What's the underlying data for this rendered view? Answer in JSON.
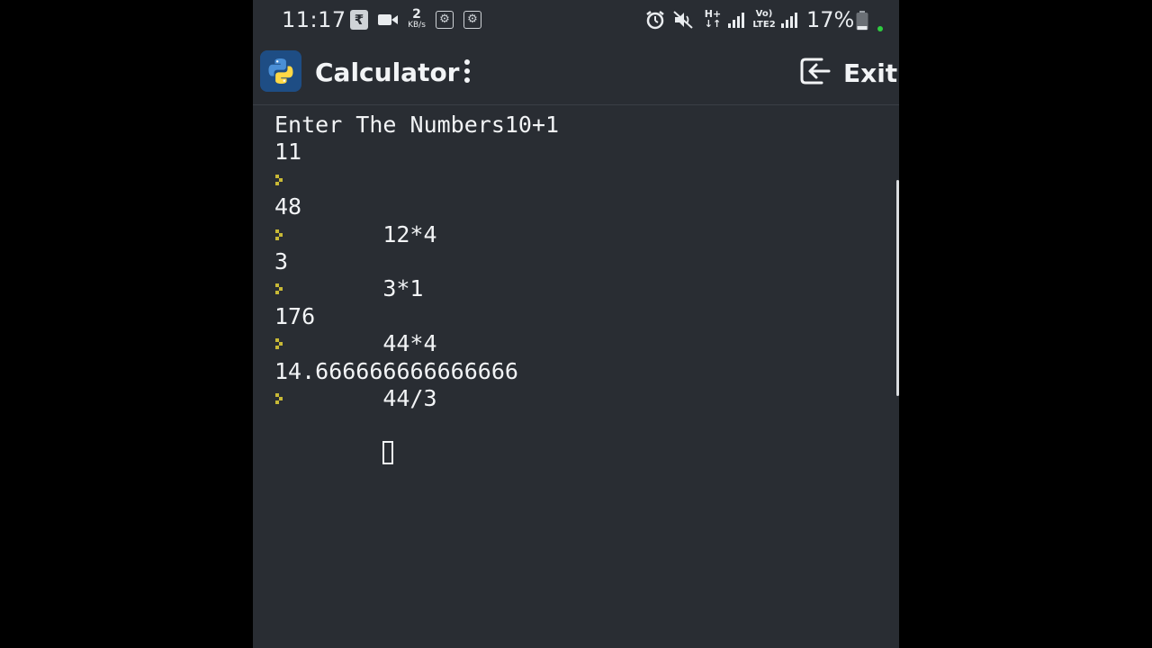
{
  "status_bar": {
    "time": "11:17",
    "data_speed_value": "2",
    "data_speed_unit": "KB/s",
    "battery_percent": "17%",
    "network_label_volte": "Vo)",
    "network_label_lte": "LTE2",
    "network_label_hplus": "H+"
  },
  "app_bar": {
    "title": "Calculator",
    "exit_label": "Exit"
  },
  "console": {
    "header_line": "Enter The Numbers10+1",
    "first_result": "11",
    "entries": [
      {
        "input": "12*4",
        "output": "48"
      },
      {
        "input": "3*1",
        "output": "3"
      },
      {
        "input": "44*4",
        "output": "176"
      },
      {
        "input": "44/3",
        "output": "14.666666666666666"
      }
    ]
  },
  "colors": {
    "background": "#292d33",
    "prompt_accent": "#c8b936",
    "text": "#f2f4f6"
  }
}
